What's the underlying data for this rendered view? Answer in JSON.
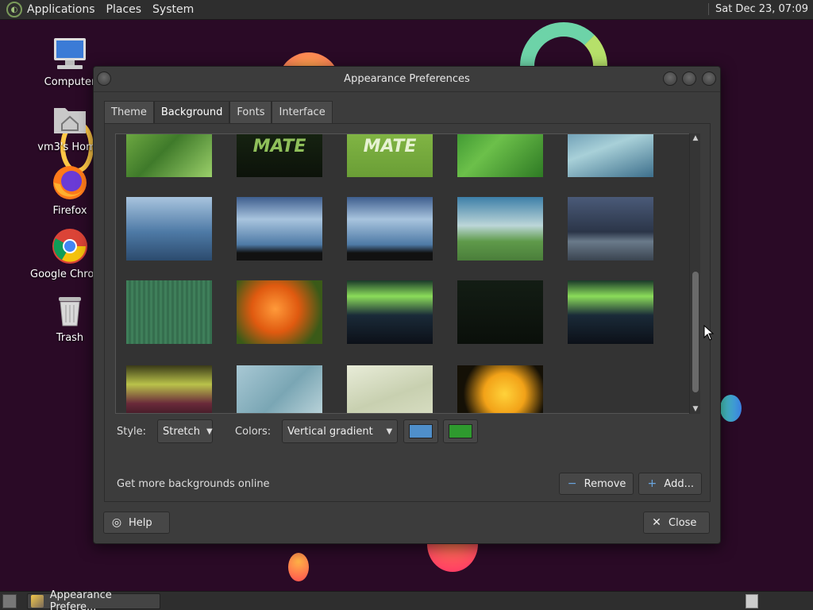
{
  "top_panel": {
    "menus": [
      "Applications",
      "Places",
      "System"
    ],
    "clock": "Sat Dec 23, 07:09"
  },
  "desktop": {
    "icons": [
      {
        "label": "Computer",
        "icon": "computer-icon"
      },
      {
        "label": "vm3's Home",
        "icon": "home-folder-icon"
      },
      {
        "label": "Firefox",
        "icon": "firefox-icon"
      },
      {
        "label": "Google Chrome",
        "icon": "chrome-icon"
      },
      {
        "label": "Trash",
        "icon": "trash-icon"
      }
    ]
  },
  "dialog": {
    "title": "Appearance Preferences",
    "tabs": [
      "Theme",
      "Background",
      "Fonts",
      "Interface"
    ],
    "active_tab": "Background",
    "style_label": "Style:",
    "style_value": "Stretch",
    "colors_label": "Colors:",
    "colors_value": "Vertical gradient",
    "primary_color": "#4f8fca",
    "secondary_color": "#2e9a2e",
    "online_link": "Get more backgrounds online",
    "remove_label": "Remove",
    "add_label": "Add...",
    "help_label": "Help",
    "close_label": "Close",
    "wallpaper_text": [
      "MATE",
      "MATE"
    ]
  },
  "taskbar": {
    "task_label": "Appearance Prefere..."
  }
}
